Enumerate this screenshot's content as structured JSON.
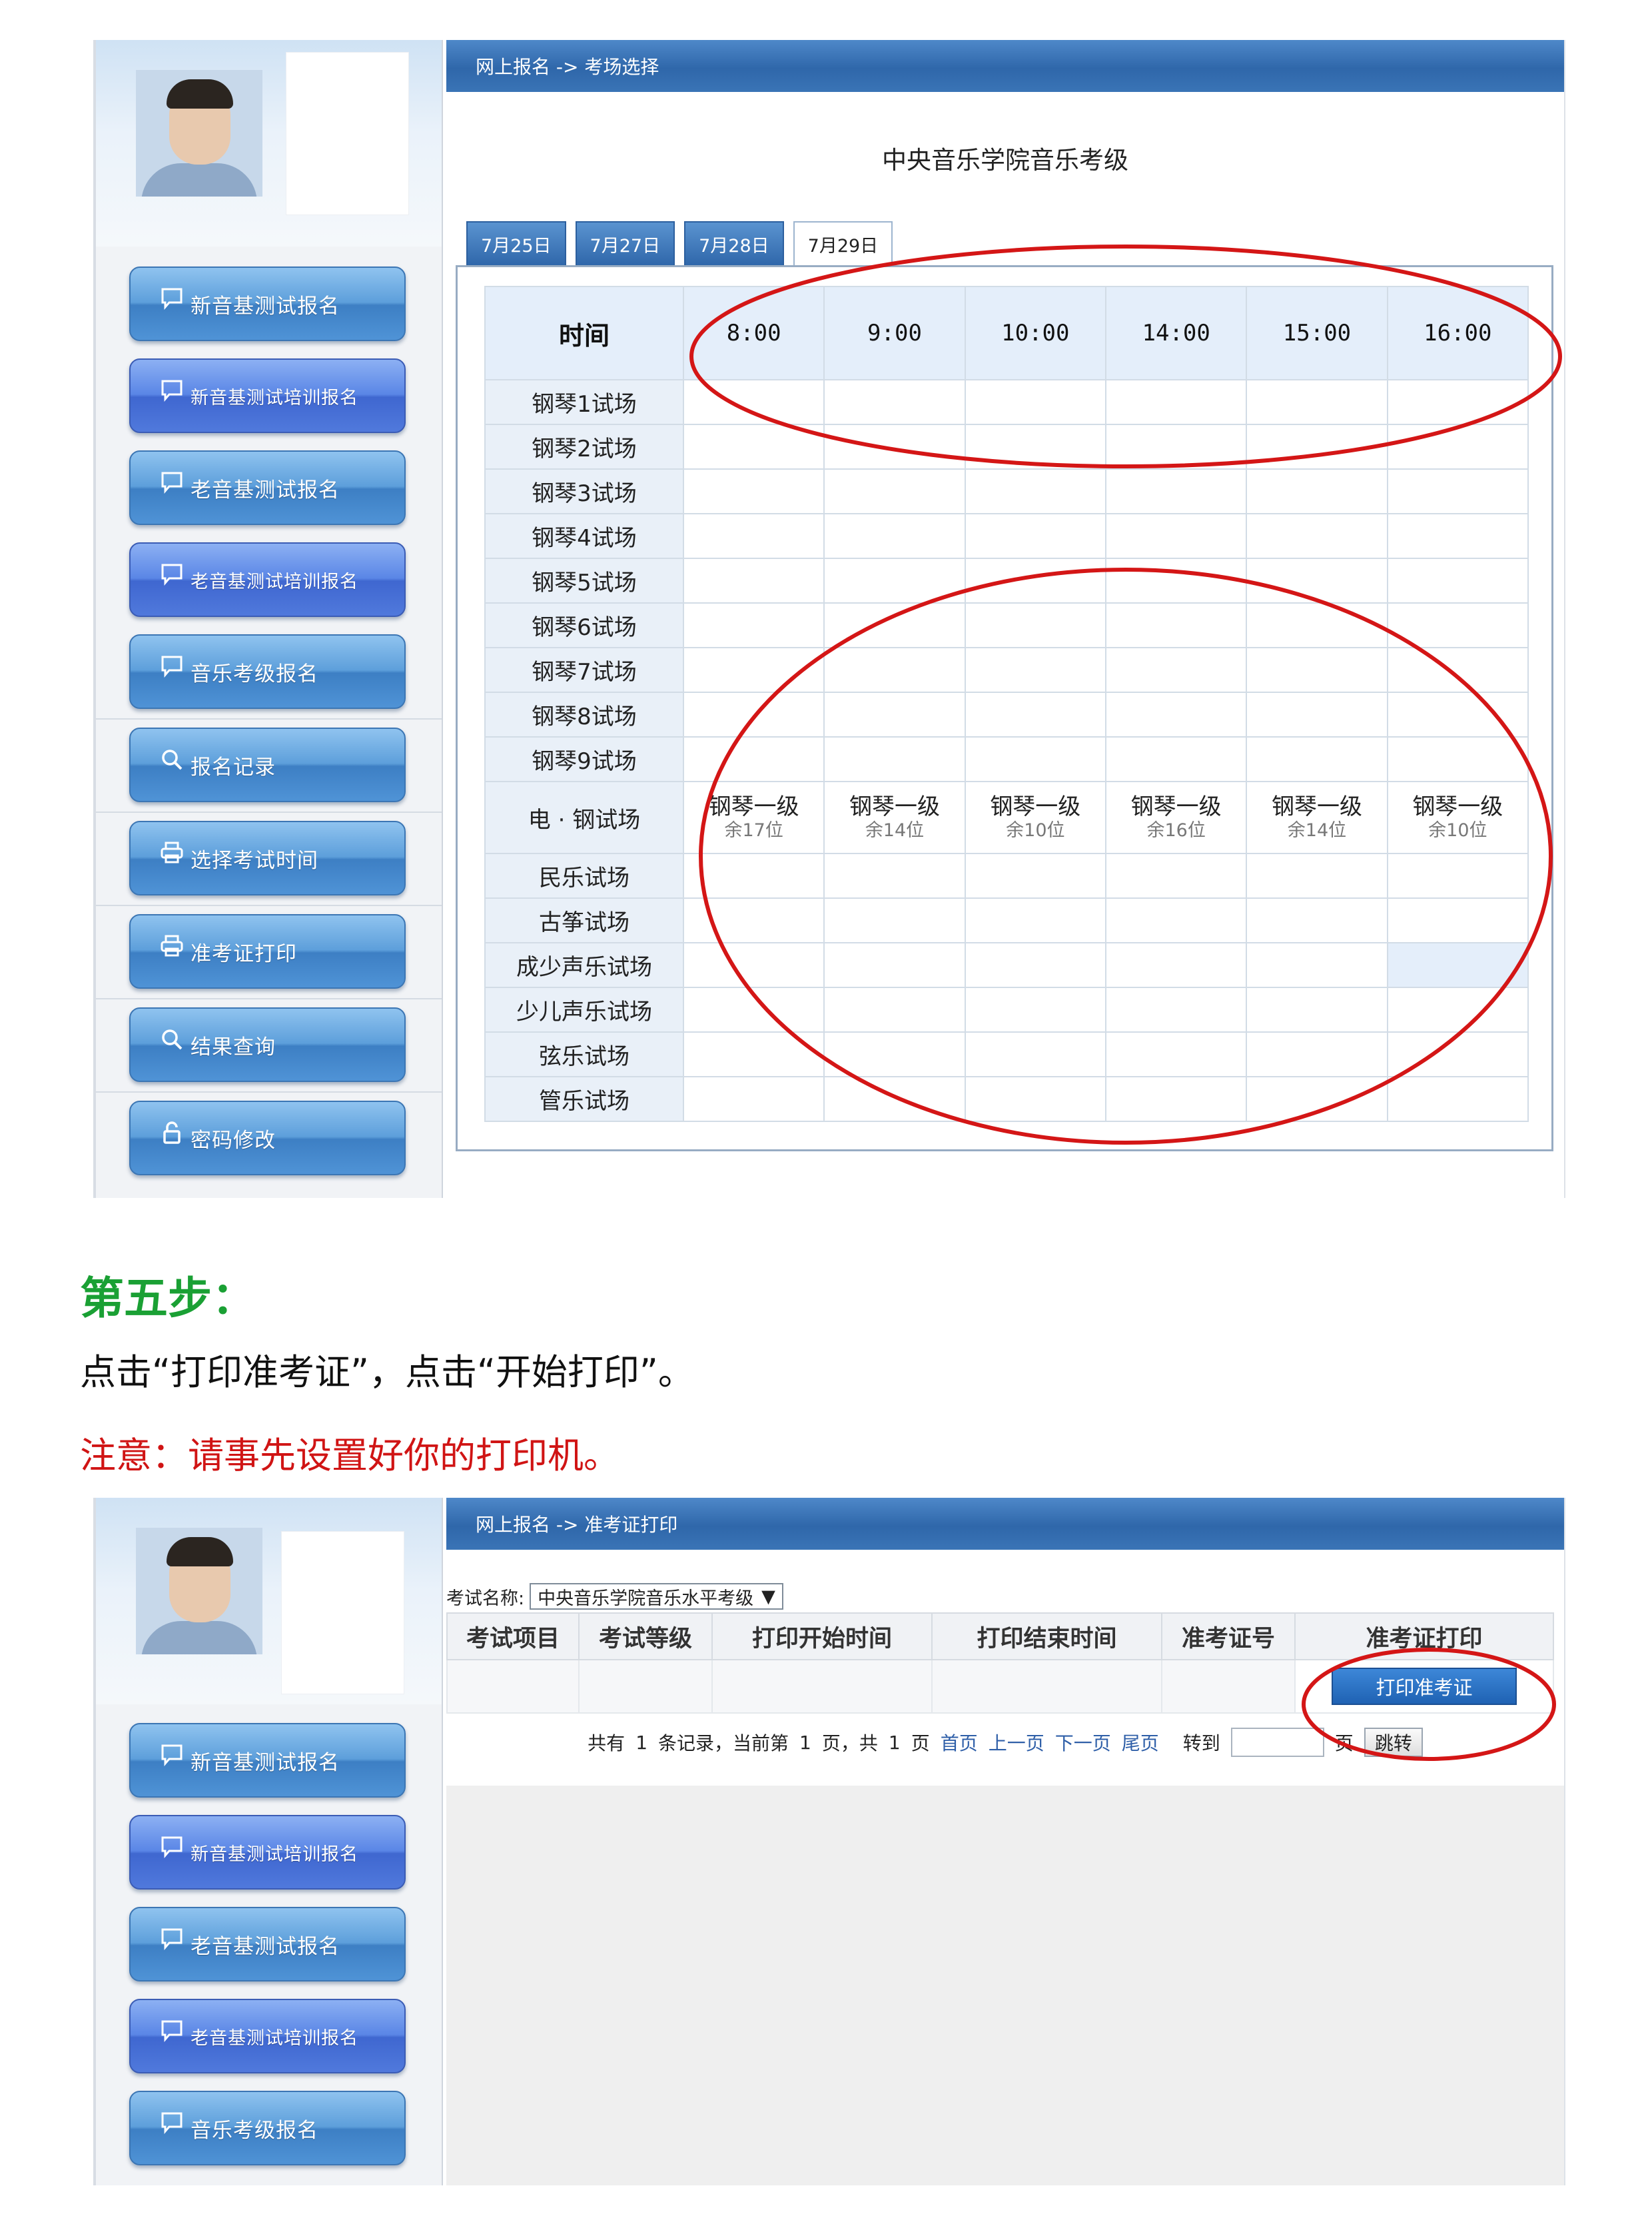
{
  "screen1": {
    "breadcrumb": "网上报名 -> 考场选择",
    "page_title": "中央音乐学院音乐考级",
    "tabs": [
      {
        "label": "7月25日",
        "active": false
      },
      {
        "label": "7月27日",
        "active": false
      },
      {
        "label": "7月28日",
        "active": false
      },
      {
        "label": "7月29日",
        "active": true
      }
    ],
    "schedule": {
      "corner": "时间",
      "times": [
        "8:00",
        "9:00",
        "10:00",
        "14:00",
        "15:00",
        "16:00"
      ],
      "rooms": [
        "钢琴1试场",
        "钢琴2试场",
        "钢琴3试场",
        "钢琴4试场",
        "钢琴5试场",
        "钢琴6试场",
        "钢琴7试场",
        "钢琴8试场",
        "钢琴9试场",
        "电 · 钢试场",
        "民乐试场",
        "古筝试场",
        "成少声乐试场",
        "少儿声乐试场",
        "弦乐试场",
        "管乐试场"
      ],
      "slot_level": "钢琴一级",
      "slot_remaining": [
        "余17位",
        "余14位",
        "余10位",
        "余16位",
        "余14位",
        "余10位"
      ]
    }
  },
  "sidebar": {
    "items": [
      {
        "label": "新音基测试报名",
        "icon": "chat-bubble-icon"
      },
      {
        "label": "新音基测试培训报名",
        "icon": "chat-bubble-icon"
      },
      {
        "label": "老音基测试报名",
        "icon": "chat-bubble-icon"
      },
      {
        "label": "老音基测试培训报名",
        "icon": "chat-bubble-icon"
      },
      {
        "label": "音乐考级报名",
        "icon": "chat-bubble-icon"
      },
      {
        "label": "报名记录",
        "icon": "search-icon"
      },
      {
        "label": "选择考试时间",
        "icon": "printer-icon"
      },
      {
        "label": "准考证打印",
        "icon": "printer-icon"
      },
      {
        "label": "结果查询",
        "icon": "search-icon"
      },
      {
        "label": "密码修改",
        "icon": "lock-icon"
      }
    ]
  },
  "instructions": {
    "step_heading": "第五步：",
    "step_text": "点击“打印准考证”，点击“开始打印”。",
    "note": "注意：请事先设置好你的打印机。"
  },
  "screen2": {
    "breadcrumb": "网上报名 -> 准考证打印",
    "exam_label": "考试名称:",
    "exam_value": "中央音乐学院音乐水平考级",
    "columns": [
      "考试项目",
      "考试等级",
      "打印开始时间",
      "打印结束时间",
      "准考证号",
      "准考证打印"
    ],
    "print_button": "打印准考证",
    "pager": {
      "total_pre": "共有",
      "total": "1",
      "records_current": "条记录，当前第",
      "current": "1",
      "page_of": "页，共",
      "pages": "1",
      "page_unit": "页",
      "first": "首页",
      "prev": "上一页",
      "next": "下一页",
      "last": "尾页",
      "goto": "转到",
      "page_suffix": "页",
      "jump": "跳转"
    }
  },
  "colors": {
    "accent_blue": "#2f67aa",
    "annotation_red": "#d41616",
    "step_green": "#1aa034"
  }
}
